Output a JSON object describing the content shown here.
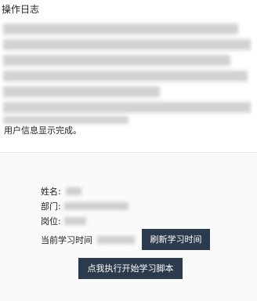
{
  "log": {
    "title": "操作日志",
    "last_line": "用户信息显示完成。"
  },
  "info": {
    "name_label": "姓名:",
    "dept_label": "部门:",
    "position_label": "岗位:",
    "study_time_label": "当前学习时间",
    "refresh_button": "刷新学习时间",
    "start_button": "点我执行开始学习脚本"
  },
  "colors": {
    "button_bg": "#2b3a4d",
    "button_text": "#ffffff"
  }
}
